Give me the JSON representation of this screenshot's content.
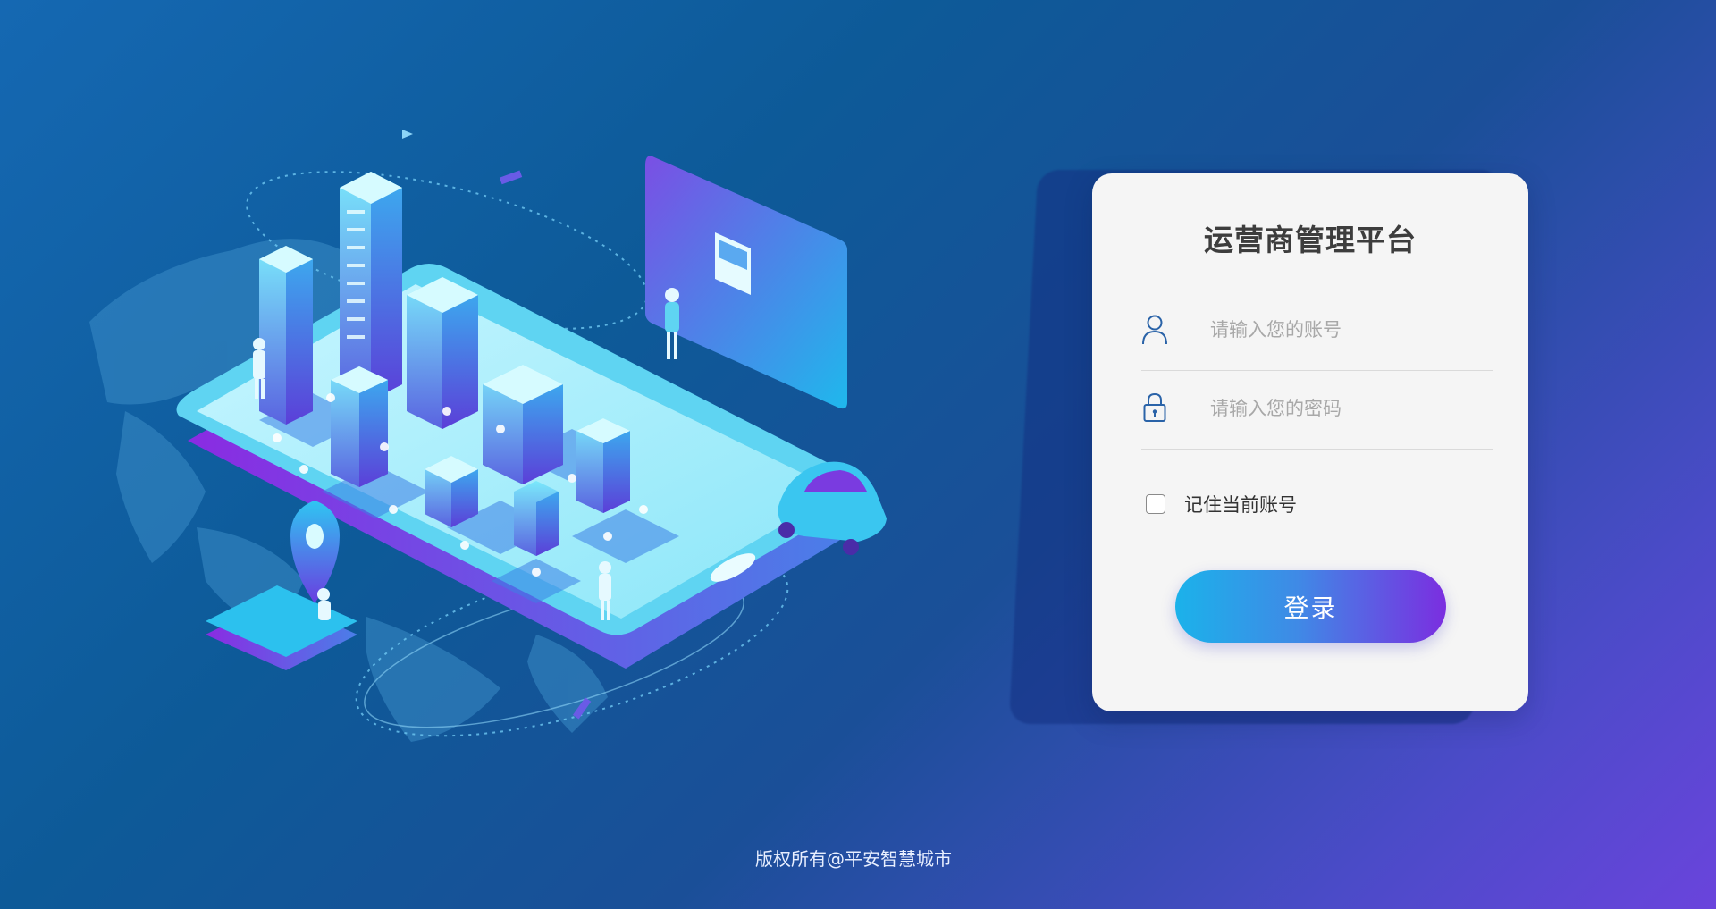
{
  "login": {
    "title": "运营商管理平台",
    "username_placeholder": "请输入您的账号",
    "username_value": "",
    "password_placeholder": "请输入您的密码",
    "password_value": "",
    "remember_label": "记住当前账号",
    "remember_checked": false,
    "submit_label": "登录"
  },
  "footer": {
    "copyright": "版权所有@平安智慧城市"
  },
  "icons": {
    "username": "user-icon",
    "password": "lock-icon"
  },
  "colors": {
    "button_start": "#1bb2ea",
    "button_end": "#7b2ee0",
    "icon": "#2a63a8",
    "background_start": "#1568b2",
    "background_end": "#6a44dc"
  }
}
